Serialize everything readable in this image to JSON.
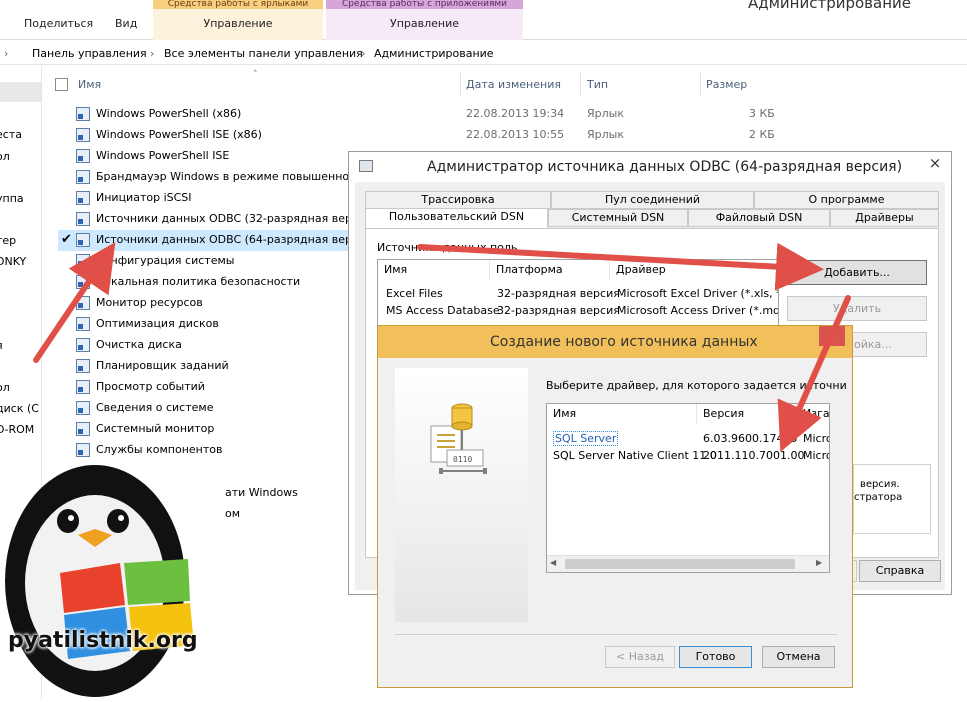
{
  "ribbon": {
    "share": "Поделиться",
    "view": "Вид",
    "ctx1_head": "Средства работы с ярлыками",
    "ctx1_label": "Управление",
    "ctx2_head": "Средства работы с приложениями",
    "ctx2_label": "Управление",
    "window_title": "Администрирование"
  },
  "breadcrumb": {
    "sep": "›",
    "items": [
      "Панель управления",
      "Все элементы панели управления",
      "Администрирование"
    ]
  },
  "nav": [
    "еста",
    "ол",
    "уппа",
    "тер",
    "DNKY",
    "я",
    "ол",
    "диск (С",
    "D-ROM"
  ],
  "columns": {
    "name": "Имя",
    "date": "Дата изменения",
    "type": "Тип",
    "size": "Размер"
  },
  "files": [
    {
      "name": "Windows PowerShell (x86)",
      "date": "22.08.2013 19:34",
      "type": "Ярлык",
      "size": "3 КБ"
    },
    {
      "name": "Windows PowerShell ISE (x86)",
      "date": "22.08.2013 10:55",
      "type": "Ярлык",
      "size": "2 КБ"
    },
    {
      "name": "Windows PowerShell ISE",
      "date": "",
      "type": "",
      "size": ""
    },
    {
      "name": "Брандмауэр Windows в режиме повышенной",
      "date": "",
      "type": "",
      "size": ""
    },
    {
      "name": "Инициатор iSCSI",
      "date": "",
      "type": "",
      "size": ""
    },
    {
      "name": "Источники данных ODBC (32-разрядная верси",
      "date": "",
      "type": "",
      "size": ""
    },
    {
      "name": "Источники данных ODBC (64-разрядная верси",
      "date": "",
      "type": "",
      "size": ""
    },
    {
      "name": "Конфигурация системы",
      "date": "",
      "type": "",
      "size": ""
    },
    {
      "name": "Локальная политика безопасности",
      "date": "",
      "type": "",
      "size": ""
    },
    {
      "name": "Монитор ресурсов",
      "date": "",
      "type": "",
      "size": ""
    },
    {
      "name": "Оптимизация дисков",
      "date": "",
      "type": "",
      "size": ""
    },
    {
      "name": "Очистка диска",
      "date": "",
      "type": "",
      "size": ""
    },
    {
      "name": "Планировщик заданий",
      "date": "",
      "type": "",
      "size": ""
    },
    {
      "name": "Просмотр событий",
      "date": "",
      "type": "",
      "size": ""
    },
    {
      "name": "Сведения о системе",
      "date": "",
      "type": "",
      "size": ""
    },
    {
      "name": "Системный монитор",
      "date": "",
      "type": "",
      "size": ""
    },
    {
      "name": "Службы компонентов",
      "date": "",
      "type": "",
      "size": ""
    }
  ],
  "partial_rows": [
    "ати Windows",
    "ом"
  ],
  "odbc": {
    "title": "Администратор источника данных ODBC (64-разрядная версия)",
    "close": "×",
    "tabs_back": [
      "Трассировка",
      "Пул соединений",
      "О программе"
    ],
    "tabs_front": [
      "Пользовательский DSN",
      "Системный DSN",
      "Файловый DSN",
      "Драйверы"
    ],
    "group_label": "Источники данных поль",
    "list_headers": [
      "Имя",
      "Платформа",
      "Драйвер"
    ],
    "rows": [
      [
        "Excel Files",
        "32-разрядная версия",
        "Microsoft Excel Driver (*.xls, *.xlsx"
      ],
      [
        "MS Access Database",
        "32-разрядная версия",
        "Microsoft Access Driver (*.mdb, *.a"
      ]
    ],
    "btn_add": "Добавить...",
    "btn_remove": "Удалить",
    "btn_configure": "ойка...",
    "info_text1": "версия.",
    "info_text2": "стратора",
    "btn_help": "Справка"
  },
  "new_ds": {
    "title": "Создание нового источника данных",
    "prompt": "Выберите драйвер, для которого задается источни",
    "headers": [
      "Имя",
      "Версия",
      "Изга"
    ],
    "drivers": [
      [
        "SQL Server",
        "6.03.9600.17415",
        "Micro"
      ],
      [
        "SQL Server Native Client 11.0",
        "2011.110.7001.00",
        "Micro"
      ]
    ],
    "btn_back": "< Назад",
    "btn_done": "Готово",
    "btn_cancel": "Отмена"
  },
  "logo": {
    "text": "pyatilistnik.org"
  },
  "colors": {
    "accent": "#3b8ed6",
    "arrow": "#e74c3c",
    "dialog_title_bg": "#f2c05a"
  }
}
